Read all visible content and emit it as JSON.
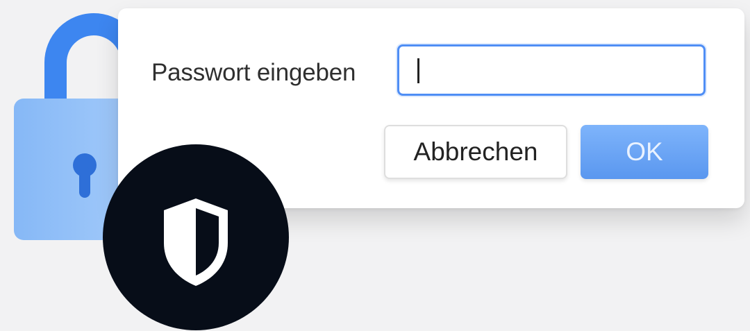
{
  "dialog": {
    "password_label": "Passwort eingeben",
    "password_value": "",
    "cancel_label": "Abbrechen",
    "ok_label": "OK"
  },
  "illustration": {
    "lock_icon": "padlock-icon",
    "keyhole_icon": "keyhole-icon",
    "shield_icon": "shield-icon"
  },
  "colors": {
    "focus_border": "#4f8ef5",
    "ok_button": "#6aa3f3",
    "lock_body": "#8cbcf8",
    "lock_shackle": "#3d86f0",
    "badge": "#070d18"
  }
}
